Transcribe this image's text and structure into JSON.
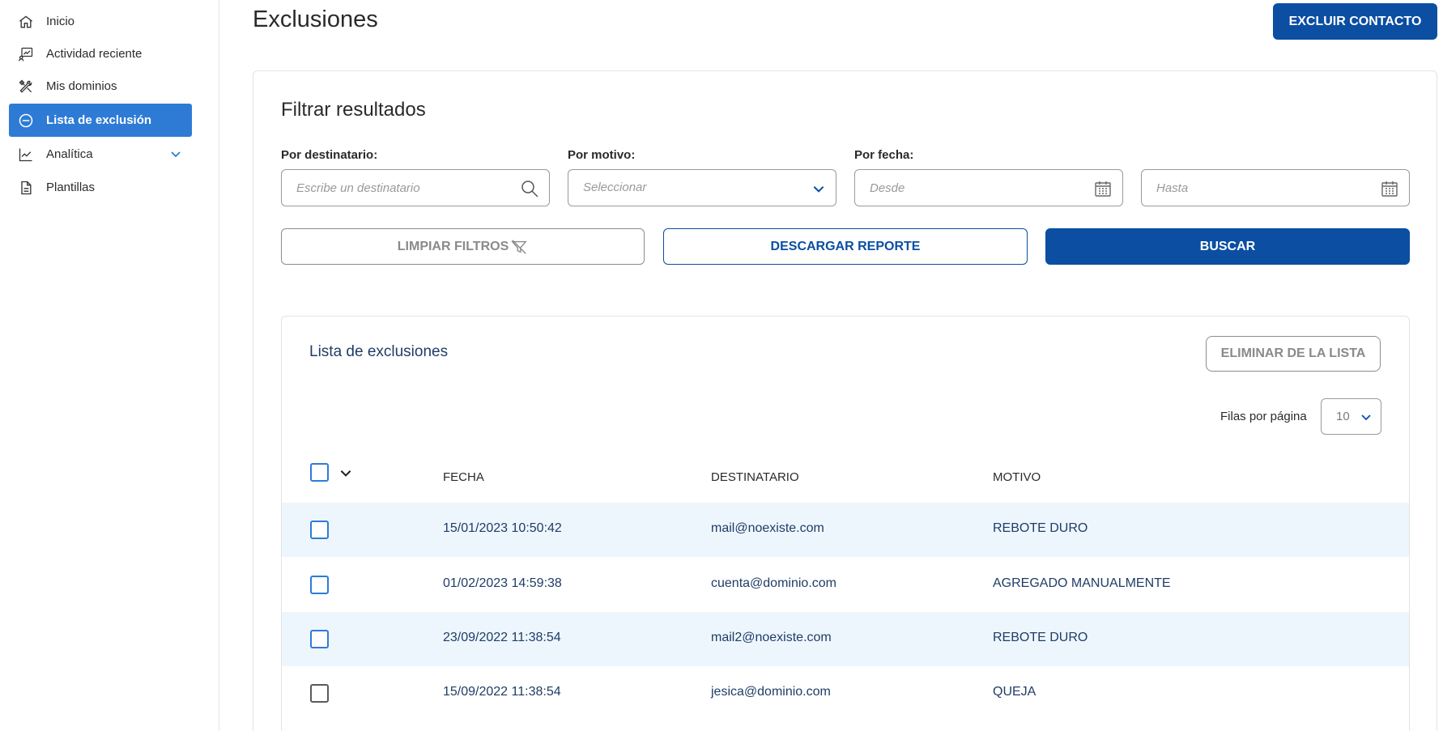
{
  "sidebar": {
    "items": [
      {
        "label": "Inicio",
        "icon": "home-icon"
      },
      {
        "label": "Actividad reciente",
        "icon": "activity-icon"
      },
      {
        "label": "Mis dominios",
        "icon": "tools-icon"
      },
      {
        "label": "Lista de exclusión",
        "icon": "block-icon",
        "active": true
      },
      {
        "label": "Analítica",
        "icon": "chart-icon"
      },
      {
        "label": "Plantillas",
        "icon": "document-icon"
      }
    ]
  },
  "header": {
    "title": "Exclusiones",
    "exclude_button": "EXCLUIR CONTACTO"
  },
  "filters": {
    "title": "Filtrar resultados",
    "recipient_label": "Por destinatario:",
    "recipient_placeholder": "Escribe un destinatario",
    "reason_label": "Por motivo:",
    "reason_value": "Seleccionar",
    "date_label": "Por fecha:",
    "from_placeholder": "Desde",
    "to_placeholder": "Hasta",
    "clear_button": "LIMPIAR FILTROS",
    "download_button": "DESCARGAR REPORTE",
    "search_button": "BUSCAR"
  },
  "list": {
    "title": "Lista de exclusiones",
    "remove_button": "ELIMINAR DE LA LISTA",
    "rows_per_page_label": "Filas por página",
    "rows_per_page_value": "10",
    "columns": [
      "FECHA",
      "DESTINATARIO",
      "MOTIVO"
    ],
    "rows": [
      {
        "date": "15/01/2023 10:50:42",
        "recipient": "mail@noexiste.com",
        "reason": "REBOTE DURO"
      },
      {
        "date": "01/02/2023 14:59:38",
        "recipient": "cuenta@dominio.com",
        "reason": "AGREGADO MANUALMENTE"
      },
      {
        "date": "23/09/2022 11:38:54",
        "recipient": "mail2@noexiste.com",
        "reason": "REBOTE DURO"
      },
      {
        "date": "15/09/2022 11:38:54",
        "recipient": "jesica@dominio.com",
        "reason": "QUEJA"
      }
    ]
  },
  "colors": {
    "primary": "#0b4ea2",
    "active_nav": "#2e7bd6",
    "row_highlight": "#eef6fd",
    "text_dark_blue": "#1f3d66"
  }
}
